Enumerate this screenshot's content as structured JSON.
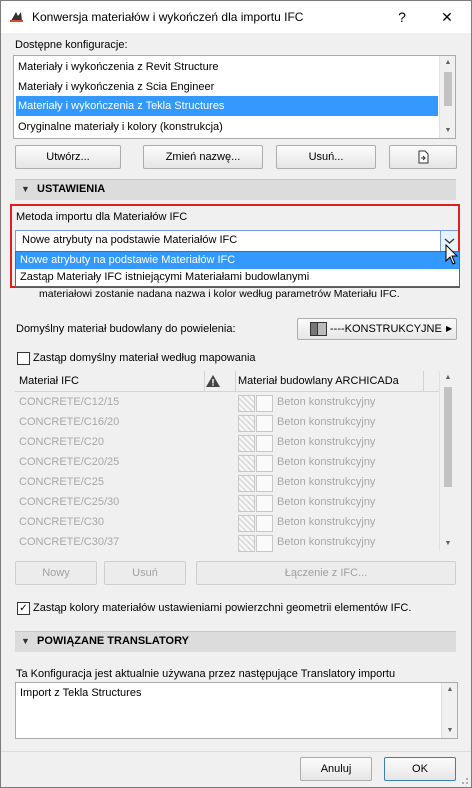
{
  "window": {
    "title": "Konwersja materiałów i wykończeń dla importu IFC",
    "help": "?",
    "close": "✕"
  },
  "configurations": {
    "label": "Dostępne konfiguracje:",
    "items": [
      "Materiały i wykończenia z Revit Structure",
      "Materiały i wykończenia z Scia Engineer",
      "Materiały i wykończenia z Tekla Structures",
      "Oryginalne materiały i kolory (konstrukcja)"
    ],
    "selected_index": 2,
    "buttons": {
      "create": "Utwórz...",
      "rename": "Zmień nazwę...",
      "delete": "Usuń..."
    }
  },
  "settings": {
    "header": "USTAWIENIA",
    "method_label": "Metoda importu dla Materiałów IFC",
    "method_value": "Nowe atrybuty na podstawie Materiałów IFC",
    "dropdown_options": [
      "Nowe atrybuty na podstawie Materiałów IFC",
      "Zastąp Materiały IFC istniejącymi Materiałami budowlanymi"
    ],
    "partial_text": "materiałowi zostanie nadana nazwa i kolor według parametrów Materiału IFC.",
    "default_material_label": "Domyślny materiał budowlany do powielenia:",
    "default_material_value": "----KONSTRUKCYJNE",
    "replace_default_label": "Zastąp domyślny materiał według mapowania",
    "table": {
      "col_ifc": "Materiał IFC",
      "col_archicad": "Materiał budowlany ARCHICADa",
      "rows": [
        {
          "ifc": "CONCRETE/C12/15",
          "mat": "Beton konstrukcyjny"
        },
        {
          "ifc": "CONCRETE/C16/20",
          "mat": "Beton konstrukcyjny"
        },
        {
          "ifc": "CONCRETE/C20",
          "mat": "Beton konstrukcyjny"
        },
        {
          "ifc": "CONCRETE/C20/25",
          "mat": "Beton konstrukcyjny"
        },
        {
          "ifc": "CONCRETE/C25",
          "mat": "Beton konstrukcyjny"
        },
        {
          "ifc": "CONCRETE/C25/30",
          "mat": "Beton konstrukcyjny"
        },
        {
          "ifc": "CONCRETE/C30",
          "mat": "Beton konstrukcyjny"
        },
        {
          "ifc": "CONCRETE/C30/37",
          "mat": "Beton konstrukcyjny"
        }
      ]
    },
    "row_buttons": {
      "new": "Nowy",
      "delete": "Usuń",
      "join": "Łączenie z IFC..."
    },
    "override_colors_label": "Zastąp kolory materiałów ustawieniami powierzchni geometrii elementów IFC.",
    "override_colors_checked": true
  },
  "translators": {
    "header": "POWIĄZANE TRANSLATORY",
    "info": "Ta Konfiguracja jest aktualnie używana przez następujące Translatory importu",
    "items": [
      "Import z Tekla Structures"
    ]
  },
  "footer": {
    "cancel": "Anuluj",
    "ok": "OK"
  },
  "colors": {
    "selection": "#3399ff",
    "highlight_border": "#e0201b",
    "section_bg": "#dcdcdc"
  }
}
